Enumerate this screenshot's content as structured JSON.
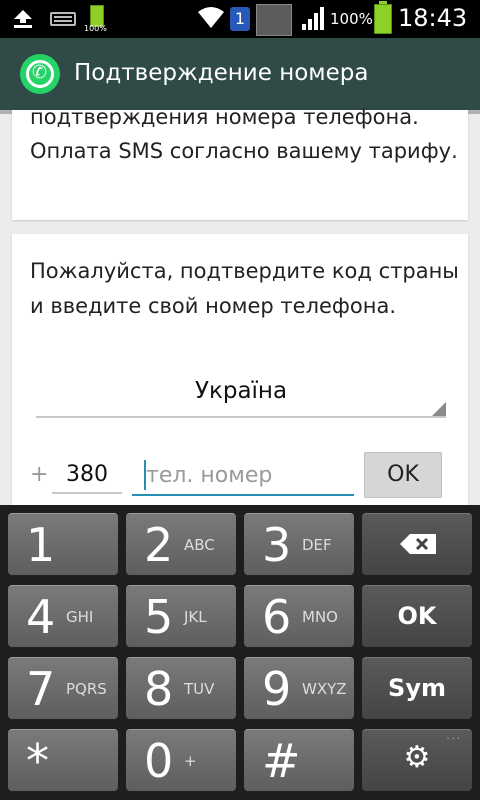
{
  "status_bar": {
    "battery_small_label": "100%",
    "notification_count": "1",
    "battery_percent": "100%",
    "time": "18:43"
  },
  "app": {
    "title": "Подтверждение номера"
  },
  "card1": {
    "text": "подтверждения номера телефона. Оплата SMS согласно вашему тарифу."
  },
  "card2": {
    "instruction": "Пожалуйста, подтвердите код страны и введите свой номер телефона.",
    "country": "Україна",
    "plus": "+",
    "country_code": "380",
    "phone_placeholder": "тел. номер",
    "ok_label": "OK"
  },
  "keyboard": {
    "keys": [
      {
        "digit": "1",
        "letters": ""
      },
      {
        "digit": "2",
        "letters": "ABC"
      },
      {
        "digit": "3",
        "letters": "DEF"
      },
      {
        "digit": "4",
        "letters": "GHI"
      },
      {
        "digit": "5",
        "letters": "JKL"
      },
      {
        "digit": "6",
        "letters": "MNO"
      },
      {
        "digit": "7",
        "letters": "PQRS"
      },
      {
        "digit": "8",
        "letters": "TUV"
      },
      {
        "digit": "9",
        "letters": "WXYZ"
      },
      {
        "digit": "*",
        "letters": ""
      },
      {
        "digit": "0",
        "letters": "+"
      },
      {
        "digit": "#",
        "letters": ""
      }
    ],
    "ok_label": "OK",
    "sym_label": "Sym",
    "backspace_icon": "backspace-icon",
    "settings_icon": "gear-icon"
  },
  "colors": {
    "title_bar": "#2f4a47",
    "whatsapp_green": "#25d366",
    "input_accent": "#2a8eb0"
  }
}
